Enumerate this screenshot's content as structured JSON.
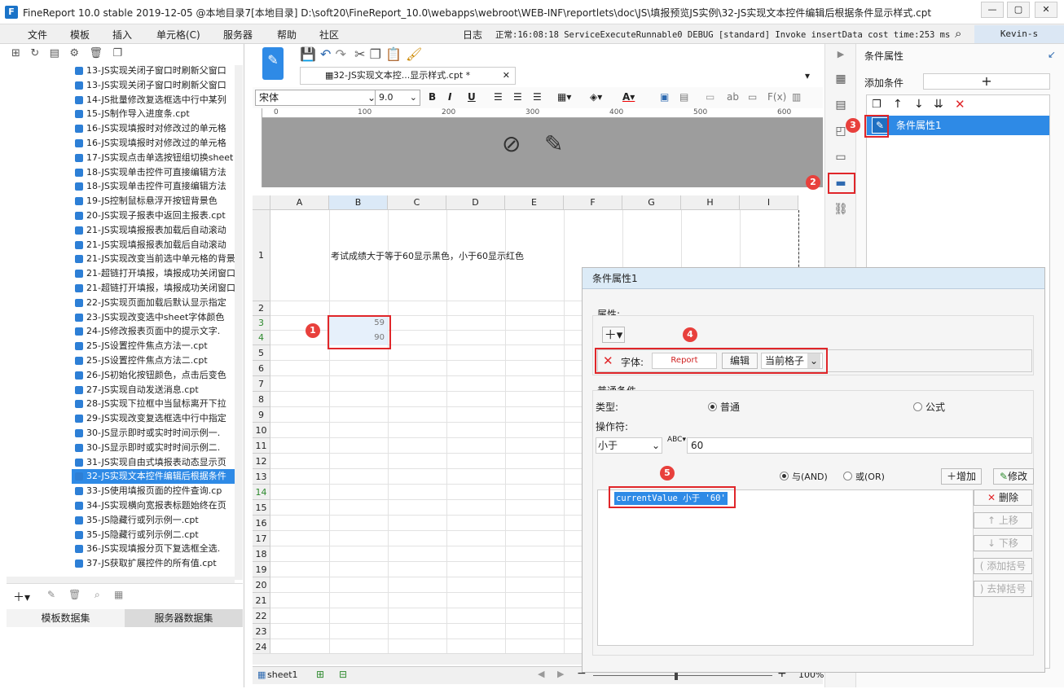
{
  "window": {
    "title": "FineReport 10.0 stable 2019-12-05 @本地目录7[本地目录]    D:\\soft20\\FineReport_10.0\\webapps\\webroot\\WEB-INF\\reportlets\\doc\\JS\\填报预览JS实例\\32-JS实现文本控件编辑后根据条件显示样式.cpt",
    "min": "—",
    "max": "▢",
    "close": "✕"
  },
  "menu": {
    "items": [
      "文件",
      "模板",
      "插入",
      "单元格(C)",
      "服务器",
      "帮助",
      "社区"
    ],
    "log_label": "日志",
    "log_text": "正常:16:08:18 ServiceExecuteRunnable0 DEBUG [standard] Invoke insertData cost time:253 ms",
    "user": "Kevin-s"
  },
  "tree": {
    "items": [
      "13-JS实现关闭子窗口时刷新父窗口",
      "13-JS实现关闭子窗口时刷新父窗口",
      "14-JS批量修改复选框选中行中某列",
      "15-JS制作导入进度条.cpt",
      "16-JS实现填报时对修改过的单元格",
      "16-JS实现填报时对修改过的单元格",
      "17-JS实现点击单选按钮组切换sheet",
      "18-JS实现单击控件可直接编辑方法",
      "18-JS实现单击控件可直接编辑方法",
      "19-JS控制鼠标悬浮开按钮背景色",
      "20-JS实现子报表中返回主报表.cpt",
      "21-JS实现填报报表加载后自动滚动",
      "21-JS实现填报报表加载后自动滚动",
      "21-JS实现改变当前选中单元格的背景",
      "21-超链打开填报，填报成功关闭窗口",
      "21-超链打开填报，填报成功关闭窗口",
      "22-JS实现页面加载后默认显示指定",
      "23-JS实现改变选中sheet字体颜色",
      "24-JS修改报表页面中的提示文字.",
      "25-JS设置控件焦点方法一.cpt",
      "25-JS设置控件焦点方法二.cpt",
      "26-JS初始化按钮颜色，点击后变色",
      "27-JS实现自动发送消息.cpt",
      "28-JS实现下拉框中当鼠标离开下拉",
      "29-JS实现改变复选框选中行中指定",
      "30-JS显示即时或实时时间示例一.",
      "30-JS显示即时或实时时间示例二.",
      "31-JS实现自由式填报表动态显示页",
      "32-JS实现文本控件编辑后根据条件",
      "33-JS使用填报页面的控件查询.cp",
      "34-JS实现横向宽报表标题始终在页",
      "35-JS隐藏行或列示例一.cpt",
      "35-JS隐藏行或列示例二.cpt",
      "36-JS实现填报分页下复选框全选.",
      "37-JS获取扩展控件的所有值.cpt"
    ],
    "selected_index": 28
  },
  "datasets": {
    "template": "模板数据集",
    "server": "服务器数据集"
  },
  "doc_tab": {
    "label": "32-JS实现文本控...显示样式.cpt *",
    "close": "✕"
  },
  "format": {
    "font": "宋体",
    "size": "9.0"
  },
  "ruler": {
    "marks": [
      "0",
      "100",
      "200",
      "300",
      "400",
      "500",
      "600"
    ]
  },
  "sheet": {
    "columns": [
      "A",
      "B",
      "C",
      "D",
      "E",
      "F",
      "G",
      "H",
      "I"
    ],
    "rows": [
      "1",
      "2",
      "3",
      "4",
      "5",
      "6",
      "7",
      "8",
      "9",
      "10",
      "11",
      "12",
      "13",
      "14",
      "15",
      "16",
      "17",
      "18",
      "19",
      "20",
      "21",
      "22",
      "23",
      "24"
    ],
    "cell_b1": "考试成绩大于等于60显示黑色，小于60显示红色",
    "cell_b3": "59",
    "cell_b4": "90",
    "sheet_tab": "sheet1",
    "zoom": "100%"
  },
  "right_panel": {
    "header": "条件属性",
    "add_condition": "添加条件",
    "cond_item": "条件属性1"
  },
  "dialog": {
    "title": "条件属性1",
    "attr_label": "属性:",
    "font_label": "字体:",
    "font_preview": "Report",
    "edit": "编辑",
    "scope": "当前格子",
    "normal_cond": "普通条件",
    "type_label": "类型:",
    "type_normal": "普通",
    "type_formula": "公式",
    "op_label": "操作符:",
    "op_value": "小于",
    "op_input": "60",
    "and_label": "与(AND)",
    "or_label": "或(OR)",
    "add": "增加",
    "modify": "修改",
    "condition": "currentValue 小于 '60'",
    "delete": "删除",
    "up": "上移",
    "down": "下移",
    "add_bracket": "添加括号",
    "remove_bracket": "去掉括号"
  },
  "badges": [
    "1",
    "2",
    "3",
    "4",
    "5"
  ],
  "colors": {
    "accent": "#2e8ae6",
    "annotation": "#e0262a"
  }
}
